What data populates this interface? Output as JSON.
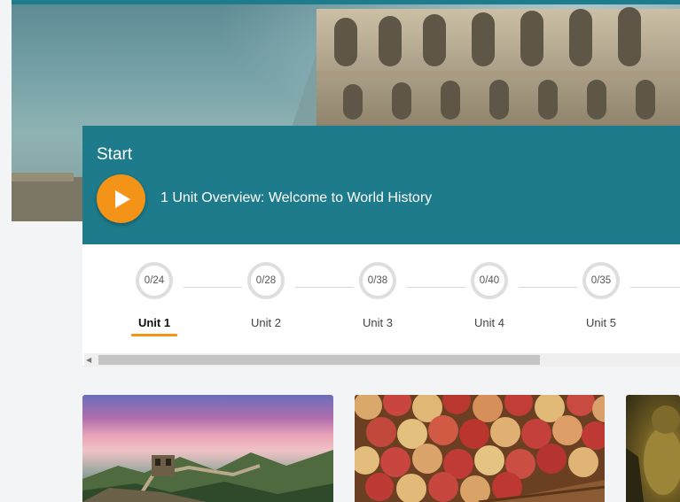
{
  "hero": {
    "start_title": "Start",
    "lesson": "1 Unit Overview: Welcome to World History"
  },
  "units": [
    {
      "label": "Unit 1",
      "progress": "0/24",
      "active": true
    },
    {
      "label": "Unit 2",
      "progress": "0/28",
      "active": false
    },
    {
      "label": "Unit 3",
      "progress": "0/38",
      "active": false
    },
    {
      "label": "Unit 4",
      "progress": "0/40",
      "active": false
    },
    {
      "label": "Unit 5",
      "progress": "0/35",
      "active": false
    }
  ],
  "colors": {
    "accent": "#f39418",
    "panel": "#1d7b8c",
    "background": "#f3f4f5"
  },
  "cards": [
    {
      "image": "great-wall-image"
    },
    {
      "image": "apples-image"
    },
    {
      "image": "buddha-image"
    }
  ]
}
